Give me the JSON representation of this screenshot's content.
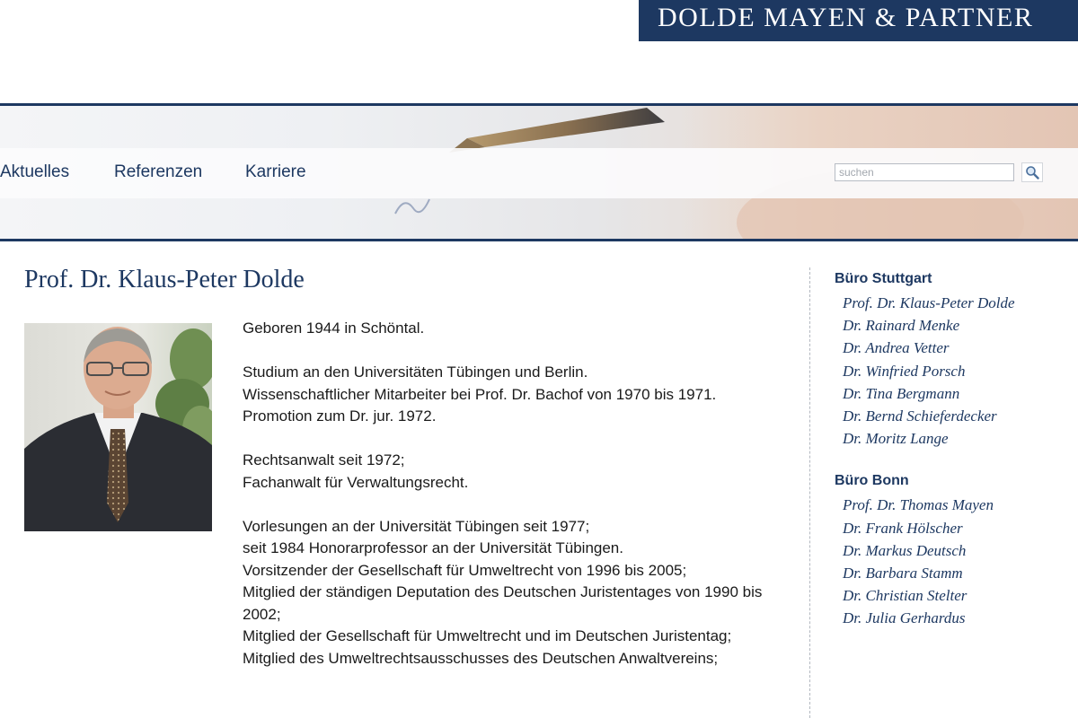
{
  "brand": {
    "logo_text": "DOLDE MAYEN & PARTNER",
    "logo_bg": "#1d3861"
  },
  "nav": {
    "items": [
      {
        "label": "Aktuelles"
      },
      {
        "label": "Referenzen"
      },
      {
        "label": "Karriere"
      }
    ],
    "search": {
      "placeholder": "suchen",
      "value": "",
      "button_icon": "magnifier-icon"
    }
  },
  "main": {
    "title": "Prof. Dr. Klaus-Peter Dolde",
    "photo_icon": "portrait-photo",
    "bio": [
      [
        "Geboren 1944 in Schöntal."
      ],
      [
        "Studium an den Universitäten Tübingen und Berlin.",
        "Wissenschaftlicher Mitarbeiter bei Prof. Dr. Bachof von 1970 bis 1971.",
        "Promotion zum Dr. jur. 1972."
      ],
      [
        "Rechtsanwalt seit 1972;",
        "Fachanwalt für Verwaltungsrecht."
      ],
      [
        "Vorlesungen an der Universität Tübingen seit 1977;",
        "seit 1984 Honorarprofessor an der Universität Tübingen.",
        "Vorsitzender der Gesellschaft für Umweltrecht von 1996 bis 2005;",
        "Mitglied der ständigen Deputation des Deutschen Juristentages von 1990 bis 2002;",
        "Mitglied der Gesellschaft für Umweltrecht und im Deutschen Juristentag;",
        "Mitglied des Umweltrechtsausschusses des Deutschen Anwaltvereins;"
      ]
    ]
  },
  "sidebar": {
    "offices": [
      {
        "heading": "Büro Stuttgart",
        "people": [
          "Prof. Dr. Klaus-Peter Dolde",
          "Dr. Rainard Menke",
          "Dr. Andrea Vetter",
          "Dr. Winfried Porsch",
          "Dr. Tina Bergmann",
          "Dr. Bernd Schieferdecker",
          "Dr. Moritz Lange"
        ]
      },
      {
        "heading": "Büro Bonn",
        "people": [
          "Prof. Dr. Thomas Mayen",
          "Dr. Frank Hölscher",
          "Dr. Markus Deutsch",
          "Dr. Barbara Stamm",
          "Dr. Christian Stelter",
          "Dr. Julia Gerhardus"
        ]
      }
    ]
  },
  "colors": {
    "accent": "#1d3861",
    "text": "#1a1a1a",
    "divider": "#b3b8c0"
  }
}
